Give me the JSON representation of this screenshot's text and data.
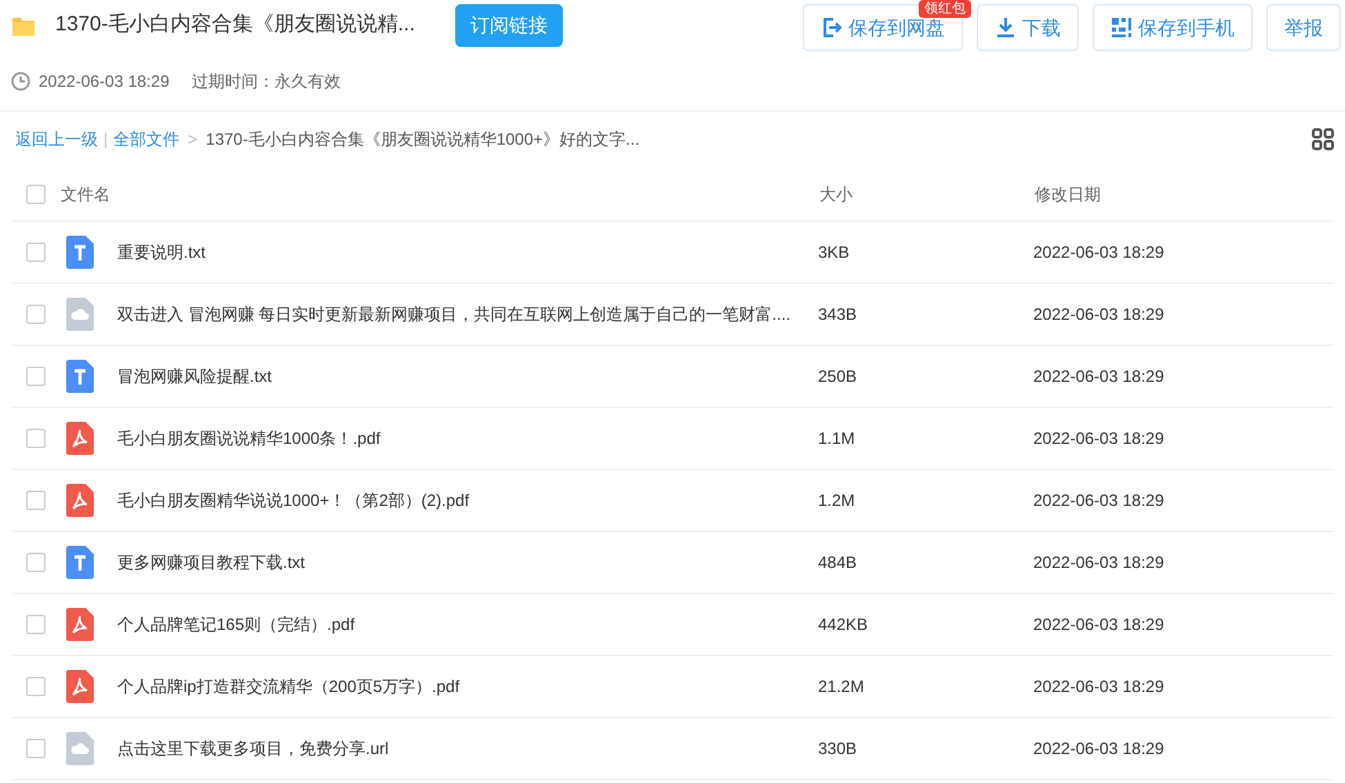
{
  "header": {
    "title": "1370-毛小白内容合集《朋友圈说说精...",
    "subscribe_button": "订阅链接",
    "date": "2022-06-03 18:29",
    "expiry": "过期时间：永久有效"
  },
  "actions": [
    {
      "label": "保存到网盘",
      "kind": "save",
      "badge": "领红包"
    },
    {
      "label": "下载",
      "kind": "download"
    },
    {
      "label": "保存到手机",
      "kind": "qr"
    },
    {
      "label": "举报",
      "kind": "plain"
    }
  ],
  "breadcrumb": {
    "back": "返回上一级",
    "divider": "|",
    "root": "全部文件",
    "separator": ">",
    "current": "1370-毛小白内容合集《朋友圈说说精华1000+》好的文字..."
  },
  "table": {
    "all_checked": false,
    "columns": [
      "文件名",
      "大小",
      "修改日期"
    ],
    "rows": [
      {
        "name": "重要说明.txt",
        "kind": "txt",
        "size": "3KB",
        "date": "2022-06-03 18:29",
        "checked": false
      },
      {
        "name": "双击进入 冒泡网赚 每日实时更新最新网赚项目，共同在互联网上创造属于自己的一笔财富....",
        "kind": "url",
        "size": "343B",
        "date": "2022-06-03 18:29",
        "checked": false
      },
      {
        "name": "冒泡网赚风险提醒.txt",
        "kind": "txt",
        "size": "250B",
        "date": "2022-06-03 18:29",
        "checked": false
      },
      {
        "name": "毛小白朋友圈说说精华1000条！.pdf",
        "kind": "pdf",
        "size": "1.1M",
        "date": "2022-06-03 18:29",
        "checked": false
      },
      {
        "name": "毛小白朋友圈精华说说1000+！（第2部）(2).pdf",
        "kind": "pdf",
        "size": "1.2M",
        "date": "2022-06-03 18:29",
        "checked": false
      },
      {
        "name": "更多网赚项目教程下载.txt",
        "kind": "txt",
        "size": "484B",
        "date": "2022-06-03 18:29",
        "checked": false
      },
      {
        "name": "个人品牌笔记165则（完结）.pdf",
        "kind": "pdf",
        "size": "442KB",
        "date": "2022-06-03 18:29",
        "checked": false
      },
      {
        "name": "个人品牌ip打造群交流精华（200页5万字）.pdf",
        "kind": "pdf",
        "size": "21.2M",
        "date": "2022-06-03 18:29",
        "checked": false
      },
      {
        "name": "点击这里下载更多项目，免费分享.url",
        "kind": "url",
        "size": "330B",
        "date": "2022-06-03 18:29",
        "checked": false
      }
    ]
  }
}
